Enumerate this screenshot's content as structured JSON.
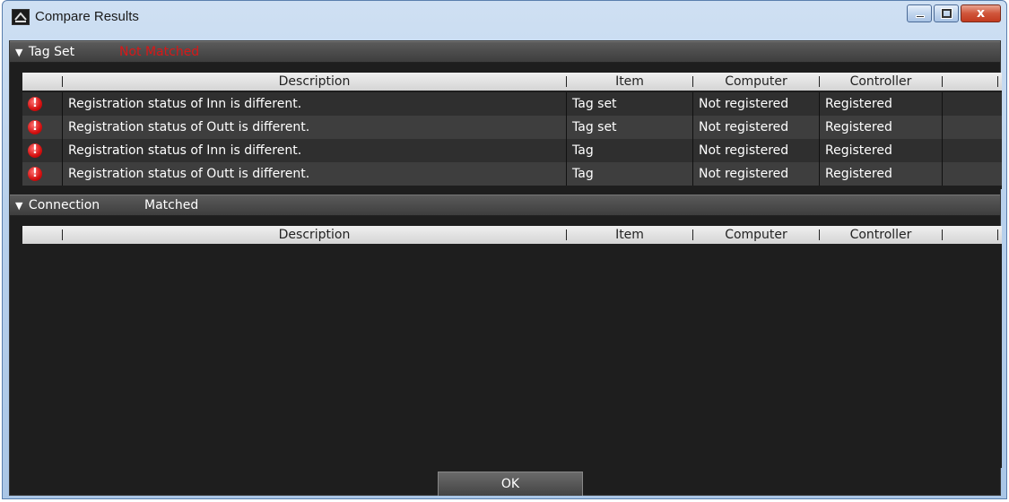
{
  "window": {
    "title": "Compare Results",
    "icons": {
      "app": "app-icon",
      "minimize": "minimize-icon",
      "maximize": "maximize-icon",
      "close": "close-icon"
    },
    "close_glyph": "x"
  },
  "tagset": {
    "header": "Tag Set",
    "status": "Not Matched",
    "status_color": "#d81818",
    "columns": {
      "description": "Description",
      "item": "Item",
      "computer": "Computer",
      "controller": "Controller"
    },
    "rows": [
      {
        "icon": "error-icon",
        "description": "Registration status of Inn is different.",
        "item": "Tag set",
        "computer": "Not registered",
        "controller": "Registered"
      },
      {
        "icon": "error-icon",
        "description": "Registration status of Outt is different.",
        "item": "Tag set",
        "computer": "Not registered",
        "controller": "Registered"
      },
      {
        "icon": "error-icon",
        "description": "Registration status of Inn is different.",
        "item": "Tag",
        "computer": "Not registered",
        "controller": "Registered"
      },
      {
        "icon": "error-icon",
        "description": "Registration status of Outt is different.",
        "item": "Tag",
        "computer": "Not registered",
        "controller": "Registered"
      }
    ]
  },
  "connection": {
    "header": "Connection",
    "status": "Matched",
    "columns": {
      "description": "Description",
      "item": "Item",
      "computer": "Computer",
      "controller": "Controller"
    }
  },
  "footer": {
    "ok_label": "OK"
  }
}
